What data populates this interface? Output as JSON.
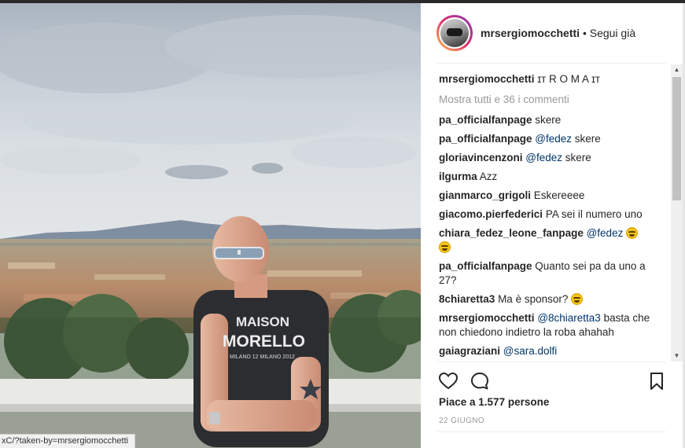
{
  "post": {
    "username": "mrsergiomocchetti",
    "separator": "•",
    "follow_status": "Segui già",
    "caption": "ɪᴛ R O M A ɪᴛ",
    "load_more": "Mostra tutti e 36 i commenti",
    "likes": "Piace a 1.577 persone",
    "date": "22 GIUGNO"
  },
  "comments": [
    {
      "user": "pa_officialfanpage",
      "mention": "",
      "text": "skere",
      "emoji": false
    },
    {
      "user": "pa_officialfanpage",
      "mention": "@fedez",
      "text": "skere",
      "emoji": false
    },
    {
      "user": "gloriavincenzoni",
      "mention": "@fedez",
      "text": "skere",
      "emoji": false
    },
    {
      "user": "ilgurma",
      "mention": "",
      "text": "Azz",
      "emoji": false
    },
    {
      "user": "gianmarco_grigoli",
      "mention": "",
      "text": "Eskereeee",
      "emoji": false
    },
    {
      "user": "giacomo.pierfederici",
      "mention": "",
      "text": "PA sei il numero uno",
      "emoji": false
    },
    {
      "user": "chiara_fedez_leone_fanpage",
      "mention": "@fedez",
      "text": "",
      "emoji": true
    },
    {
      "user": "pa_officialfanpage",
      "mention": "",
      "text": "Quanto sei pa da uno a 27?",
      "emoji": false
    },
    {
      "user": "8chiaretta3",
      "mention": "",
      "text": "Ma è sponsor?",
      "emoji": true
    },
    {
      "user": "mrsergiomocchetti",
      "mention": "@8chiaretta3",
      "text": "basta che non chiedono indietro la roba ahahah",
      "emoji": false
    },
    {
      "user": "gaiagraziani",
      "mention": "@sara.dolfi",
      "text": "",
      "emoji": false
    }
  ],
  "photo": {
    "shirt_line1": "MAISON",
    "shirt_line2": "MORELLO",
    "shirt_line3": "MILANO 12 MILANO 2012"
  },
  "statusbar": {
    "url": "xC/?taken-by=mrsergiomocchetti"
  },
  "icons": {
    "like": "heart-icon",
    "comment": "comment-bubble-icon",
    "save": "bookmark-icon",
    "scroll_up": "▲",
    "scroll_down": "▼"
  },
  "colors": {
    "mention": "#003569",
    "muted": "#999999",
    "text": "#262626"
  }
}
